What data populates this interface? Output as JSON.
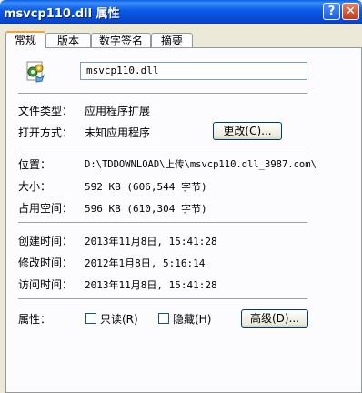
{
  "window": {
    "title": "msvcp110.dll 属性",
    "help_label": "?",
    "close_label": "✕"
  },
  "tabs": [
    {
      "label": "常规",
      "active": true
    },
    {
      "label": "版本",
      "active": false
    },
    {
      "label": "数字签名",
      "active": false
    },
    {
      "label": "摘要",
      "active": false
    }
  ],
  "general": {
    "filename": "msvcp110.dll",
    "icon": "dll-file-icon",
    "file_type_label": "文件类型：",
    "file_type": "应用程序扩展",
    "open_with_label": "打开方式：",
    "open_with": "未知应用程序",
    "change_button": "更改(C)...",
    "location_label": "位置：",
    "location": "D:\\TDDOWNLOAD\\上传\\msvcp110.dll_3987.com\\",
    "size_label": "大小：",
    "size": "592 KB (606,544 字节)",
    "size_on_disk_label": "占用空间：",
    "size_on_disk": "596 KB (610,304 字节)",
    "created_label": "创建时间：",
    "created": "2013年11月8日, 15:41:28",
    "modified_label": "修改时间：",
    "modified": "2012年1月8日, 5:16:14",
    "accessed_label": "访问时间：",
    "accessed": "2013年11月8日, 15:41:28",
    "attributes_label": "属性：",
    "readonly_label": "只读(R)",
    "readonly_checked": false,
    "hidden_label": "隐藏(H)",
    "hidden_checked": false,
    "advanced_button": "高级(D)..."
  }
}
